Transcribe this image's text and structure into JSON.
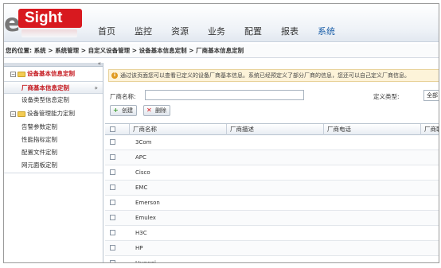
{
  "header": {
    "logo_prefix": "e",
    "logo_text": "Sight",
    "nav": [
      {
        "label": "首页"
      },
      {
        "label": "监控"
      },
      {
        "label": "资源"
      },
      {
        "label": "业务"
      },
      {
        "label": "配置"
      },
      {
        "label": "报表"
      },
      {
        "label": "系统"
      }
    ],
    "active_nav": "系统"
  },
  "breadcrumb": "您的位置: 系统 > 系统管理 > 自定义设备管理 > 设备基本信息定制 > 厂商基本信息定制",
  "sidebar": {
    "collapse_glyph": "«",
    "groups": [
      {
        "label": "设备基本信息定制",
        "items": [
          {
            "label": "厂商基本信息定制",
            "arrow": "»"
          },
          {
            "label": "设备类型信息定制"
          }
        ]
      },
      {
        "label": "设备管理能力定制",
        "items": [
          {
            "label": "告警参数定制"
          },
          {
            "label": "性能指标定制"
          },
          {
            "label": "配置文件定制"
          },
          {
            "label": "网元面板定制"
          }
        ]
      }
    ]
  },
  "main": {
    "notice": "通过该页面您可以查看已定义的设备厂商基本信息。系统已经预定义了部分厂商的信息，您还可以自己定义厂商信息。",
    "filter": {
      "vendor_label": "厂商名称:",
      "vendor_value": "",
      "type_label": "定义类型:",
      "type_value": "全部"
    },
    "buttons": {
      "create": "创建",
      "delete": "删除"
    },
    "table": {
      "columns": [
        "厂商名称",
        "厂商描述",
        "厂商电话",
        "厂商联"
      ],
      "rows": [
        {
          "name": "3Com"
        },
        {
          "name": "APC"
        },
        {
          "name": "Cisco"
        },
        {
          "name": "EMC"
        },
        {
          "name": "Emerson"
        },
        {
          "name": "Emulex"
        },
        {
          "name": "H3C"
        },
        {
          "name": "HP"
        },
        {
          "name": "Huawei"
        }
      ]
    }
  },
  "colors": {
    "brand_red": "#d8191f",
    "nav_active": "#1a5ea8",
    "sidebar_selected_text": "#c4161c"
  }
}
